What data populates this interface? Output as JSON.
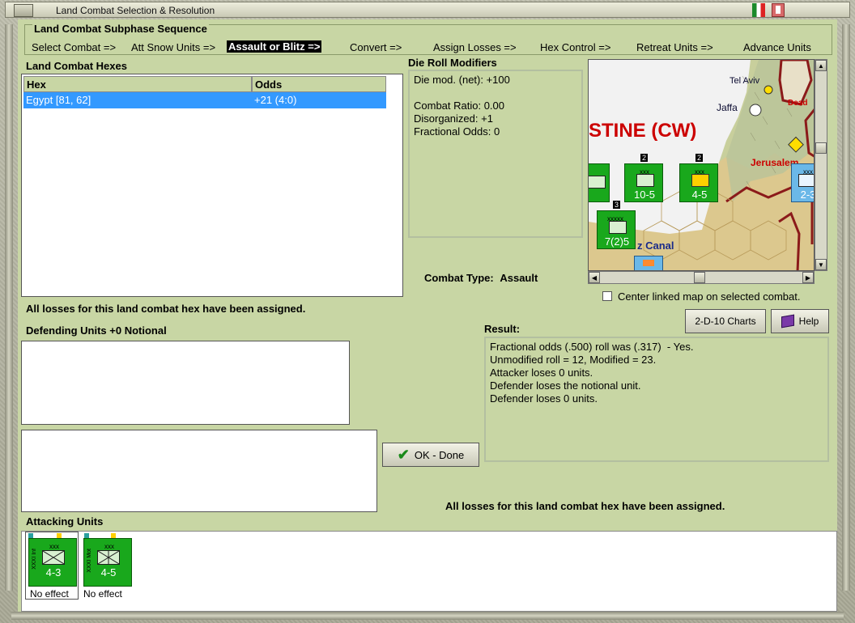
{
  "window": {
    "title": "Land Combat Selection & Resolution"
  },
  "sequence": {
    "label": "Land Combat Subphase Sequence",
    "steps": [
      "Select Combat =>",
      "Att Snow Units =>",
      "Assault or Blitz =>",
      "Convert =>",
      "Assign Losses =>",
      "Hex Control =>",
      "Retreat Units =>",
      "Advance Units"
    ],
    "active_step": "Assault or Blitz =>"
  },
  "hexes": {
    "label": "Land Combat Hexes",
    "columns": [
      "Hex",
      "Odds"
    ],
    "rows": [
      {
        "hex": "Egypt [81, 62]",
        "odds": "+21 (4:0)"
      }
    ]
  },
  "modifiers": {
    "label": "Die Roll Modifiers",
    "lines": [
      "Die mod. (net): +100",
      "Combat Ratio: 0.00",
      "Disorganized: +1",
      "Fractional Odds: 0"
    ]
  },
  "combat_type": {
    "label": "Combat Type:",
    "value": "Assault"
  },
  "map": {
    "region_text": "STINE (CW)",
    "cities": [
      "Tel Aviv",
      "Jaffa",
      "Jerusalem",
      "Dead"
    ],
    "canal_text": "z Canal",
    "stack_counts": [
      "2",
      "2",
      "3"
    ],
    "counters": [
      {
        "tag": "xxx",
        "value": "10-5"
      },
      {
        "tag": "xxx",
        "value": "4-5"
      },
      {
        "tag": "xxxxx",
        "value": "7(2)5"
      },
      {
        "tag": "xxx",
        "value": "2-3"
      }
    ]
  },
  "center_map": {
    "label": "Center linked map on selected combat.",
    "checked": false
  },
  "buttons": {
    "charts": "2-D-10 Charts",
    "help": "Help",
    "ok": "OK - Done"
  },
  "status_top": "All losses for this land combat hex have been assigned.",
  "status_bottom": "All losses for this land combat hex have been assigned.",
  "defending": {
    "label": "Defending Units +0 Notional"
  },
  "result": {
    "label": "Result:",
    "lines": [
      "Fractional odds (.500) roll was (.317)  - Yes.",
      "Unmodified roll = 12, Modified = 23.",
      "Attacker loses 0 units.",
      "Defender loses the notional unit.",
      "Defender loses 0 units."
    ]
  },
  "attacking": {
    "label": "Attacking Units",
    "units": [
      {
        "tag": "xxx",
        "name": "XXXI Inf",
        "value": "4-3",
        "status": "No effect"
      },
      {
        "tag": "xxx",
        "name": "XXXI Mot",
        "value": "4-5",
        "status": "No effect"
      }
    ]
  },
  "colors": {
    "panel_green": "#c8d6a4",
    "selection": "#3399ff",
    "unit_green": "#19a81c",
    "map_red": "#cc0000"
  }
}
